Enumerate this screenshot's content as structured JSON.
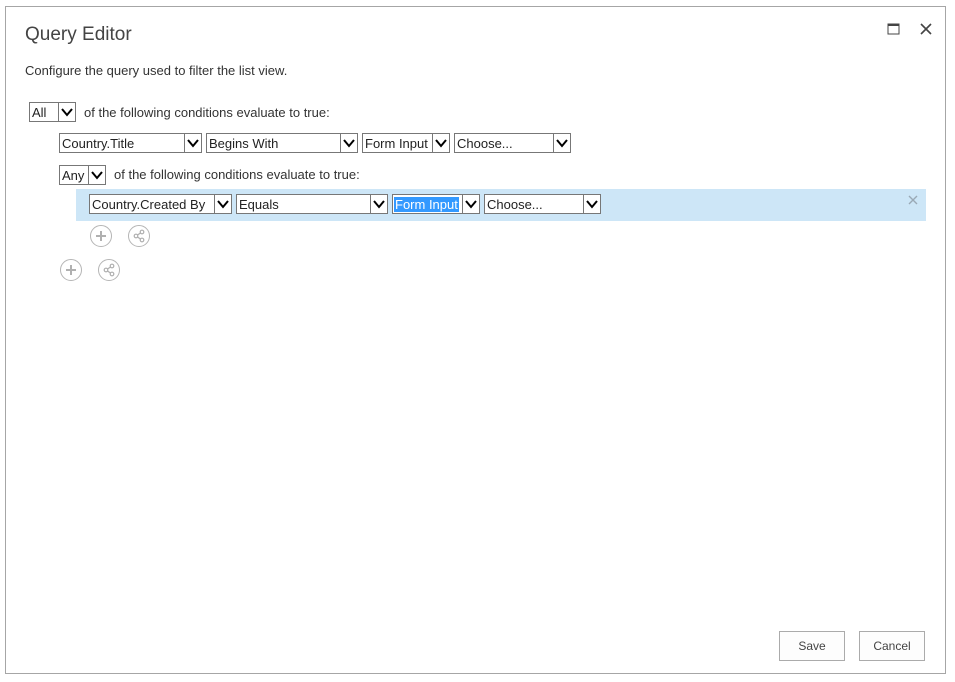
{
  "dialog": {
    "title": "Query Editor",
    "subtitle": "Configure the query used to filter the list view."
  },
  "root_group": {
    "mode": "All",
    "suffix": "of the following conditions evaluate to true:",
    "condition": {
      "field": "Country.Title",
      "operator": "Begins With",
      "source": "Form Input",
      "value": "Choose..."
    }
  },
  "nested_group": {
    "mode": "Any",
    "suffix": "of the following conditions evaluate to true:",
    "condition": {
      "field": "Country.Created By",
      "operator": "Equals",
      "source": "Form Input",
      "value": "Choose..."
    }
  },
  "buttons": {
    "save": "Save",
    "cancel": "Cancel"
  },
  "colors": {
    "row_highlight": "#cde6f7",
    "selection": "#3399ff"
  }
}
